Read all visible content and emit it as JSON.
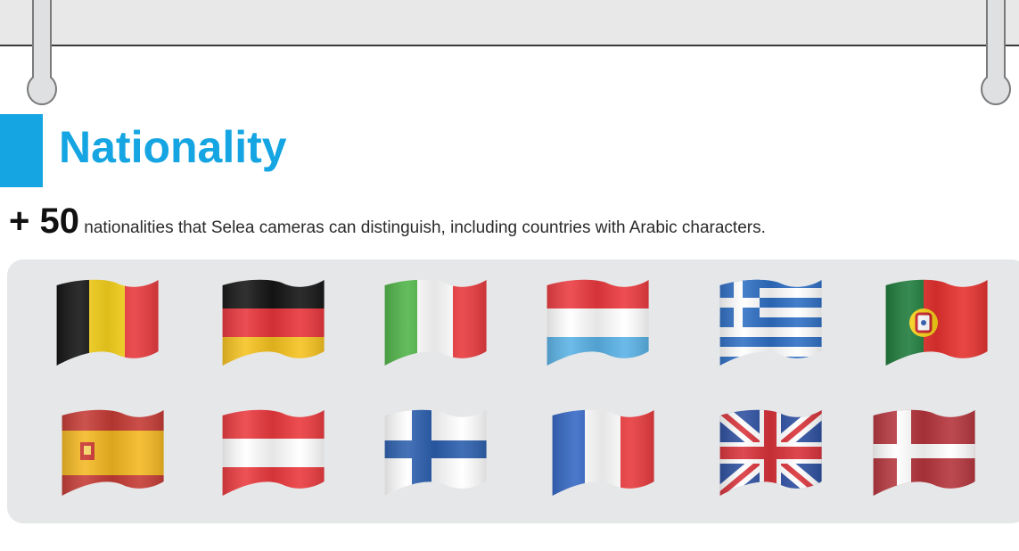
{
  "section": {
    "title": "Nationality",
    "count_prefix": "+ 50",
    "description": " nationalities that Selea cameras can distinguish, including countries with Arabic characters."
  },
  "colors": {
    "accent": "#14a5e2",
    "panel": "#e6e7e8"
  },
  "flags": [
    {
      "icon": "belgium-flag-icon",
      "country": "Belgium"
    },
    {
      "icon": "germany-flag-icon",
      "country": "Germany"
    },
    {
      "icon": "italy-flag-icon",
      "country": "Italy"
    },
    {
      "icon": "luxembourg-flag-icon",
      "country": "Luxembourg"
    },
    {
      "icon": "greece-flag-icon",
      "country": "Greece"
    },
    {
      "icon": "portugal-flag-icon",
      "country": "Portugal"
    },
    {
      "icon": "spain-flag-icon",
      "country": "Spain"
    },
    {
      "icon": "austria-flag-icon",
      "country": "Austria"
    },
    {
      "icon": "finland-flag-icon",
      "country": "Finland"
    },
    {
      "icon": "france-flag-icon",
      "country": "France"
    },
    {
      "icon": "uk-flag-icon",
      "country": "United Kingdom"
    },
    {
      "icon": "denmark-flag-icon",
      "country": "Denmark"
    }
  ]
}
